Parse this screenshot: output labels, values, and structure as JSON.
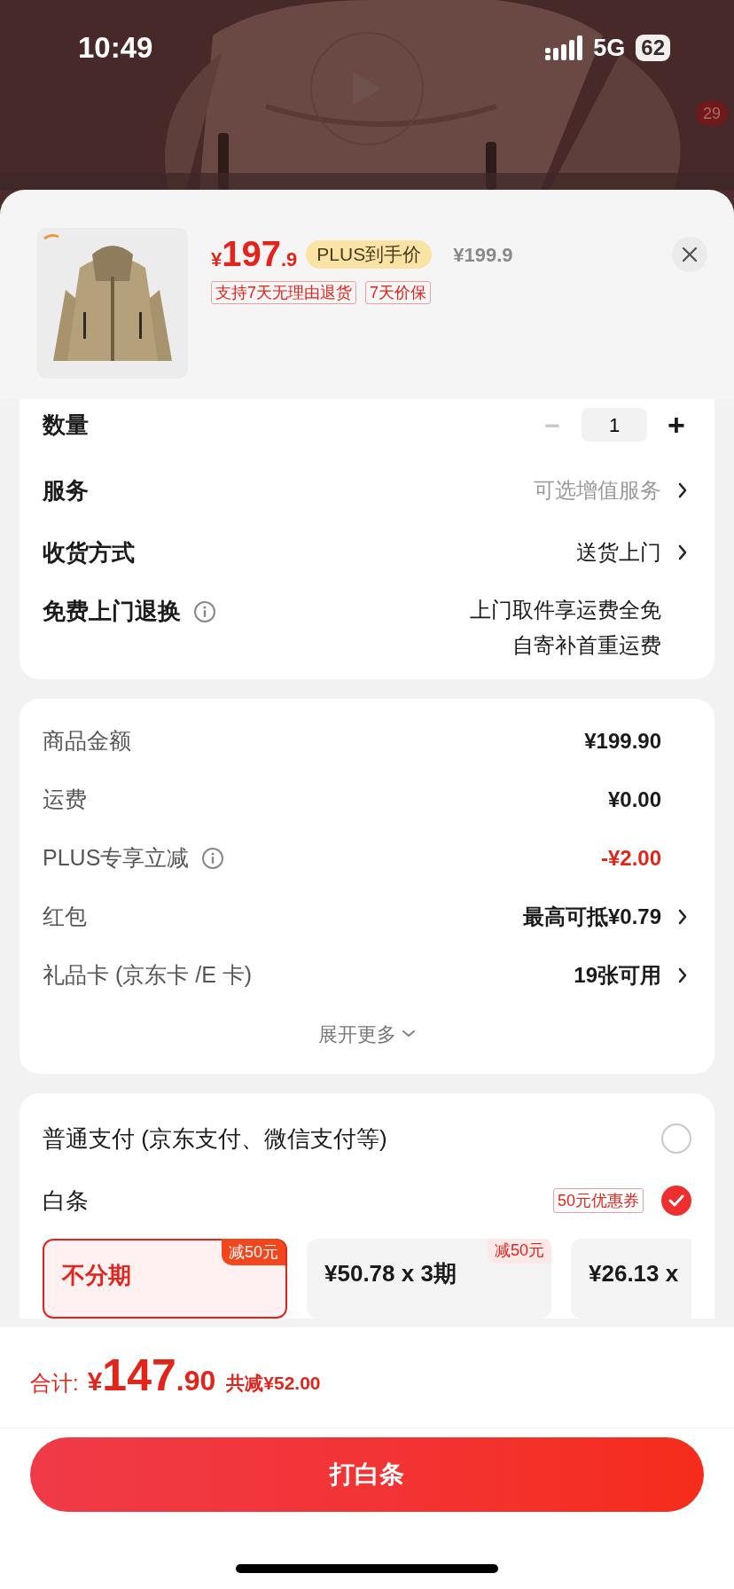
{
  "status_bar": {
    "time": "10:49",
    "network": "5G",
    "battery": "62"
  },
  "video": {
    "badge": "29"
  },
  "product": {
    "currency": "¥",
    "price_int": "197",
    "price_dec": ".9",
    "plus_label": "PLUS到手价",
    "original_price": "¥199.9",
    "tags": [
      "支持7天无理由退货",
      "7天价保"
    ]
  },
  "options": [
    {
      "kind": "stepper",
      "label": "数量",
      "minus": "−",
      "value": "1",
      "plus": "+",
      "minus_disabled": true
    },
    {
      "kind": "link",
      "label": "服务",
      "value": "可选增值服务",
      "muted": true
    },
    {
      "kind": "link",
      "label": "收货方式",
      "value": "送货上门",
      "muted": false
    },
    {
      "kind": "info",
      "label": "免费上门退换",
      "lines": [
        "上门取件享运费全免",
        "自寄补首重运费"
      ]
    }
  ],
  "costs": [
    {
      "kind": "amount",
      "label": "商品金额",
      "value": "¥199.90",
      "info": false
    },
    {
      "kind": "amount",
      "label": "运费",
      "value": "¥0.00",
      "info": false
    },
    {
      "kind": "discount",
      "label": "PLUS专享立减",
      "value": "-¥2.00",
      "info": true
    },
    {
      "kind": "link",
      "label": "红包",
      "value": "最高可抵¥0.79",
      "info": false
    },
    {
      "kind": "link",
      "label": "礼品卡 (京东卡 /E 卡)",
      "value": "19张可用",
      "info": false
    }
  ],
  "expand_more": "展开更多",
  "payment": {
    "methods": [
      {
        "label": "普通支付 (京东支付、微信支付等)",
        "selected": false
      },
      {
        "label": "白条",
        "coupon": "50元优惠券",
        "selected": true
      }
    ],
    "plans": [
      {
        "label": "不分期",
        "badge": "减50元",
        "selected": true
      },
      {
        "label": "¥50.78 x 3期",
        "badge": "减50元",
        "selected": false
      },
      {
        "label": "¥26.13 x",
        "selected": false
      }
    ]
  },
  "footer": {
    "total_label": "合计:",
    "currency": "¥",
    "total_int": "147",
    "total_dec": ".90",
    "saved": "共减¥52.00",
    "button": "打白条"
  }
}
